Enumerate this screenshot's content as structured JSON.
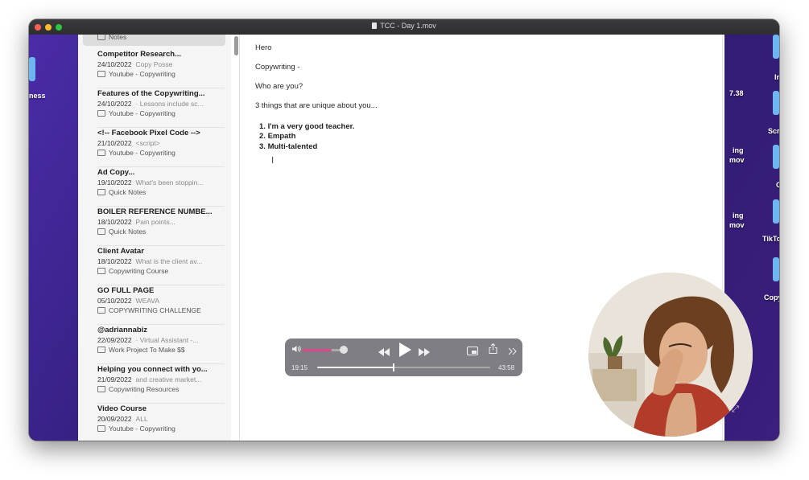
{
  "window": {
    "title": "TCC - Day 1.mov"
  },
  "colors": {
    "close": "#ff5f57",
    "minimize": "#febc2e",
    "zoom": "#28c840",
    "volume_accent": "#e0468a"
  },
  "desktop_labels": [
    "ness",
    "Ir",
    "7.38",
    "Scr",
    "ing",
    "mov",
    "C",
    "ing",
    "mov",
    "TikTo",
    "Copy"
  ],
  "sidebar": {
    "top_partial_folder": "Notes",
    "items": [
      {
        "title": "Competitor Research...",
        "date": "24/10/2022",
        "preview": "Copy Posse",
        "folder": "Youtube - Copywriting"
      },
      {
        "title": "Features of the Copywriting...",
        "date": "24/10/2022",
        "preview": "· Lessons include sc...",
        "folder": "Youtube - Copywriting"
      },
      {
        "title": "<!-- Facebook Pixel Code -->",
        "date": "21/10/2022",
        "preview": "<script>",
        "folder": "Youtube - Copywriting"
      },
      {
        "title": "Ad Copy...",
        "date": "19/10/2022",
        "preview": "What's been stoppin...",
        "folder": "Quick Notes"
      },
      {
        "title": "BOILER REFERENCE NUMBE...",
        "date": "18/10/2022",
        "preview": "Pain points...",
        "folder": "Quick Notes"
      },
      {
        "title": "Client Avatar",
        "date": "18/10/2022",
        "preview": "What is the client av...",
        "folder": "Copywriting Course"
      },
      {
        "title": "GO FULL PAGE",
        "date": "05/10/2022",
        "preview": "WEAVA",
        "folder": "COPYWRITING CHALLENGE"
      },
      {
        "title": "@adriannabiz",
        "date": "22/09/2022",
        "preview": "· Virtual Assistant -...",
        "folder": "Work Project To Make $$"
      },
      {
        "title": "Helping you connect with yo...",
        "date": "21/09/2022",
        "preview": "and creative market...",
        "folder": "Copywriting Resources"
      },
      {
        "title": "Video Course",
        "date": "20/09/2022",
        "preview": "ALL",
        "folder": "Youtube - Copywriting"
      }
    ]
  },
  "editor": {
    "paragraphs": [
      "Hero",
      "Copywriting -",
      "Who are you?",
      "3 things that are unique about you..."
    ],
    "list": [
      "I'm a very good teacher.",
      "Empath",
      "Multi-talented"
    ]
  },
  "player": {
    "current_time": "19:15",
    "total_time": "43:58",
    "progress": 0.44,
    "volume": 0.7
  }
}
